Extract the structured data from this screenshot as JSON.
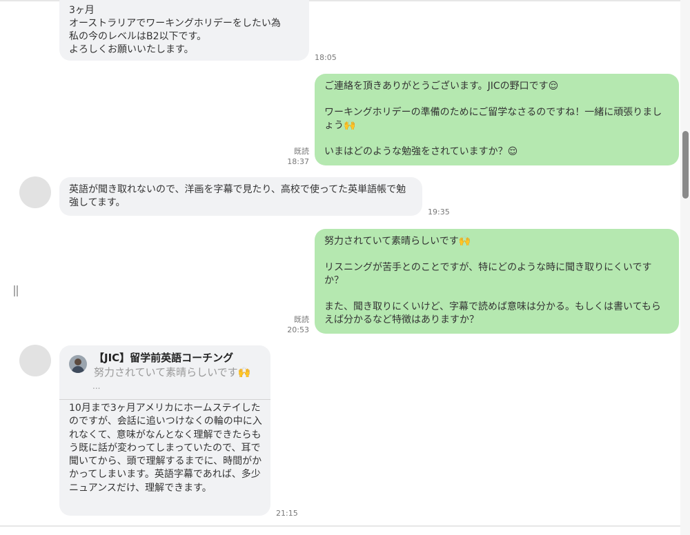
{
  "messages": [
    {
      "id": "m1",
      "direction": "incoming",
      "text": "3ヶ月\nオーストラリアでワーキングホリデーをしたい為\n私の今のレベルはB2以下です。\nよろしくお願いいたします。",
      "time": "18:05"
    },
    {
      "id": "m2",
      "direction": "outgoing",
      "text": "ご連絡を頂きありがとうございます。JICの野口です😌\n\nワーキングホリデーの準備のためにご留学なさるのですね！一緒に頑張りましょう🙌\n\nいまはどのような勉強をされていますか？😌",
      "read": "既読",
      "time": "18:37"
    },
    {
      "id": "m3",
      "direction": "incoming",
      "text": "英語が聞き取れないので、洋画を字幕で見たり、高校で使ってた英単語帳で勉強してます。",
      "time": "19:35"
    },
    {
      "id": "m4",
      "direction": "outgoing",
      "text": "努力されていて素晴らしいです🙌\n\nリスニングが苦手とのことですが、特にどのような時に聞き取りにくいですか？\n\nまた、聞き取りにくいけど、字幕で読めば意味は分かる。もしくは書いてもらえば分かるなど特徴はありますか？",
      "read": "既読",
      "time": "20:53"
    },
    {
      "id": "m5",
      "direction": "incoming",
      "quote": {
        "sender": "【JIC】留学前英語コーチング",
        "text": "努力されていて素晴らしいです🙌",
        "ellipsis": "..."
      },
      "text": "10月まで3ヶ月アメリカにホームステイしたのですが、会話に追いつけなくの輪の中に入れなくて、意味がなんとなく理解できたらもう既に話が変わってしまっていたので、耳で聞いてから、頭で理解するまでに、時間がかかってしまいます。英語字幕であれば、多少ニュアンスだけ、理解できます。",
      "time": "21:15"
    }
  ],
  "colors": {
    "incoming_bubble": "#f1f2f4",
    "outgoing_bubble": "#b5e8b0",
    "background": "#ffffff"
  },
  "icons": {
    "avatar": "user-avatar-placeholder",
    "resize_handle": "resize-handle-icon"
  }
}
